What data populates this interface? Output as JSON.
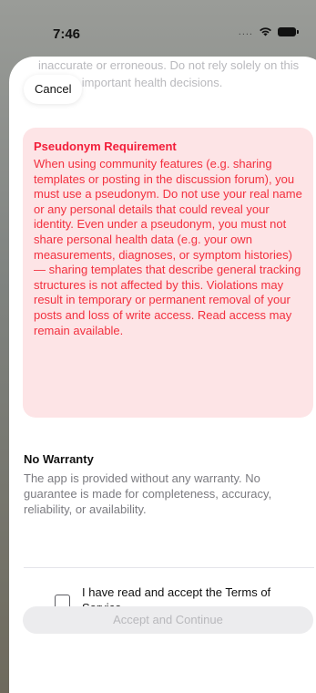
{
  "status_bar": {
    "time": "7:46",
    "signal": "....",
    "wifi_icon": "wifi-icon",
    "battery_icon": "battery-icon"
  },
  "header": {
    "cancel_label": "Cancel"
  },
  "previous_text": "inaccurate or erroneous. Do not rely solely on this data for important health decisions.",
  "pseudonym": {
    "title": "Pseudonym Requirement",
    "body": "When using community features (e.g. sharing templates or posting in the discussion forum), you must use a pseudonym. Do not use your real name or any personal details that could reveal your identity. Even under a pseudonym, you must not share personal health data (e.g. your own measurements, diagnoses, or symptom histories) — sharing templates that describe general tracking structures is not affected by this. Violations may result in temporary or permanent removal of your posts and loss of write access. Read access may remain available.",
    "bg_color": "#fde4e6",
    "text_color": "#f2303f"
  },
  "warranty": {
    "title": "No Warranty",
    "body": "The app is provided without any warranty. No guarantee is made for completeness, accuracy, reliability, or availability."
  },
  "footer": {
    "checkbox_label": "I have read and accept the Terms of Service.",
    "checkbox_checked": false,
    "accept_label": "Accept and Continue"
  }
}
